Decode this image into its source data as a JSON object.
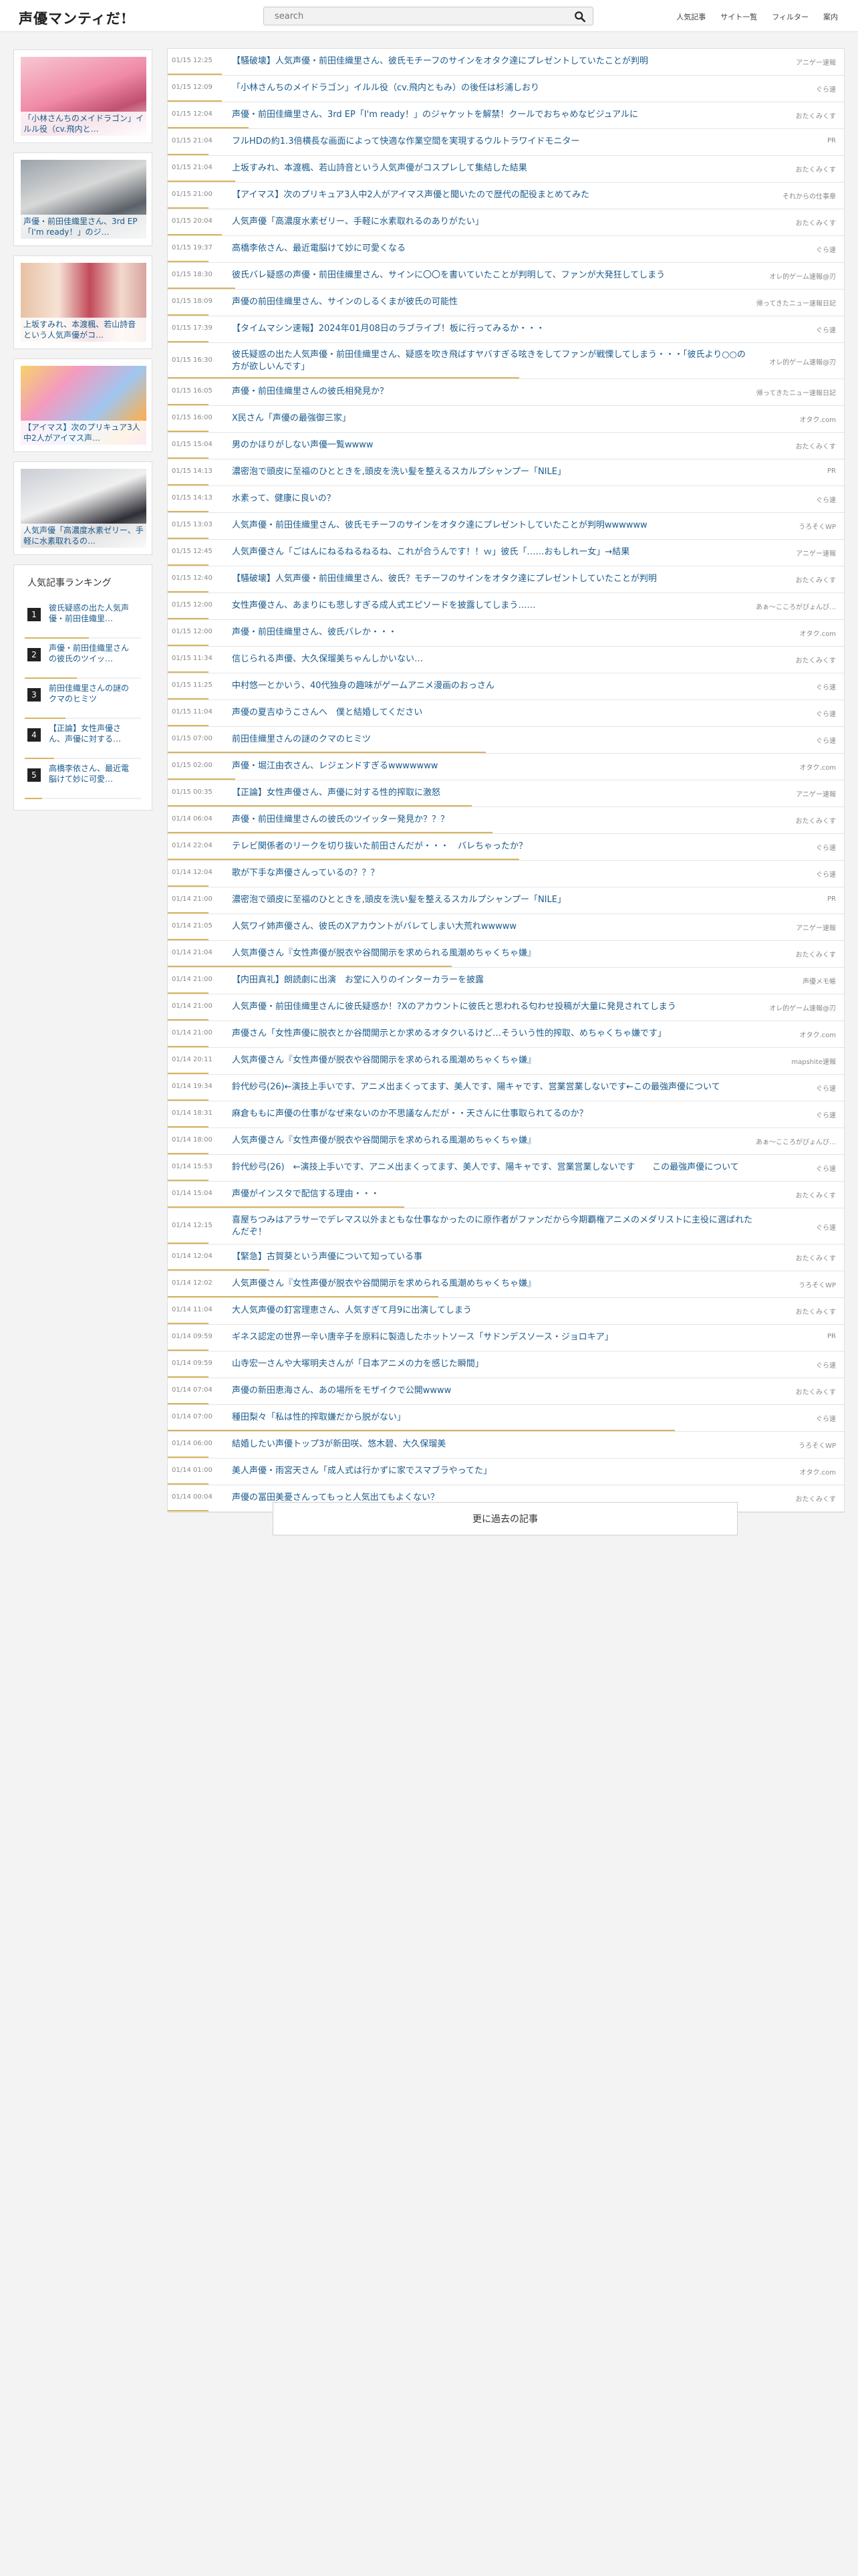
{
  "header": {
    "logo": "声優マンティだ!",
    "search_placeholder": "search",
    "nav": [
      "人気記事",
      "サイト一覧",
      "フィルター",
      "案内"
    ]
  },
  "sidebar": {
    "thumbnails": [
      {
        "caption": "「小林さんちのメイドラゴン」イルル役（cv.飛内と…"
      },
      {
        "caption": "声優・前田佳織里さん、3rd EP「I'm ready！」のジ…"
      },
      {
        "caption": "上坂すみれ、本渡楓、若山詩音という人気声優がコ…"
      },
      {
        "caption": "【アイマス】次のプリキュア3人中2人がアイマス声…"
      },
      {
        "caption": "人気声優「高濃度水素ゼリー、手軽に水素取れるの…"
      }
    ],
    "ranking": {
      "title": "人気記事ランキング",
      "items": [
        {
          "num": "1",
          "text": "彼氏疑惑の出た人気声優・前田佳織里…",
          "progress": 0.55
        },
        {
          "num": "2",
          "text": "声優・前田佳織里さんの彼氏のツイッ…",
          "progress": 0.45
        },
        {
          "num": "3",
          "text": "前田佳織里さんの謎のクマのヒミツ",
          "progress": 0.35
        },
        {
          "num": "4",
          "text": "【正論】女性声優さん、声優に対する…",
          "progress": 0.25
        },
        {
          "num": "5",
          "text": "高橋李依さん、最近電脳けて妙に可愛…",
          "progress": 0.15
        }
      ]
    }
  },
  "articles": [
    {
      "date": "01/15 12:25",
      "title": "【騒破壊】人気声優・前田佳織里さん、彼氏モチーフのサインをオタク達にプレゼントしていたことが判明",
      "source": "アニゲー速報",
      "progress": 0.08
    },
    {
      "date": "01/15 12:09",
      "title": "「小林さんちのメイドラゴン」イルル役（cv.飛内ともみ）の後任は杉浦しおり",
      "source": "ぐら速",
      "progress": 0.08
    },
    {
      "date": "01/15 12:04",
      "title": "声優・前田佳織里さん、3rd EP「I'm ready！」のジャケットを解禁！クールでおちゃめなビジュアルに",
      "source": "おたくみくす",
      "progress": 0.12
    },
    {
      "date": "01/15 21:04",
      "title": "フルHDの約1.3倍横長な画面によって快適な作業空間を実現するウルトラワイドモニター",
      "source": "PR",
      "progress": 0.06
    },
    {
      "date": "01/15 21:04",
      "title": "上坂すみれ、本渡楓、若山詩音という人気声優がコスプレして集結した結果",
      "source": "おたくみくす",
      "progress": 0.1
    },
    {
      "date": "01/15 21:00",
      "title": "【アイマス】次のプリキュア3人中2人がアイマス声優と聞いたので歴代の配役まとめてみた",
      "source": "それからの仕事章",
      "progress": 0.06
    },
    {
      "date": "01/15 20:04",
      "title": "人気声優「高濃度水素ゼリー、手軽に水素取れるのありがたい」",
      "source": "おたくみくす",
      "progress": 0.08
    },
    {
      "date": "01/15 19:37",
      "title": "高橋李依さん、最近電脳けて妙に可愛くなる",
      "source": "ぐら速",
      "progress": 0.06
    },
    {
      "date": "01/15 18:30",
      "title": "彼氏バレ疑惑の声優・前田佳織里さん、サインに〇〇を書いていたことが判明して、ファンが大発狂してしまう",
      "source": "オレ的ゲーム速報@刃",
      "progress": 0.1
    },
    {
      "date": "01/15 18:09",
      "title": "声優の前田佳織里さん、サインのしるくまが彼氏の可能性",
      "source": "帰ってきたニュー速報日記",
      "progress": 0.06
    },
    {
      "date": "01/15 17:39",
      "title": "【タイムマシン速報】2024年01月08日のラブライブ！板に行ってみるか・・・",
      "source": "ぐら速",
      "progress": 0.06
    },
    {
      "date": "01/15 16:30",
      "title": "彼氏疑惑の出た人気声優・前田佳織里さん、疑惑を吹き飛ばすヤバすぎる呟きをしてファンが戦慄してしまう・・・「彼氏より○○の方が欲しいんです」",
      "source": "オレ的ゲーム速報@刃",
      "progress": 0.52,
      "tall": true
    },
    {
      "date": "01/15 16:05",
      "title": "声優・前田佳織里さんの彼氏相発見か？",
      "source": "帰ってきたニュー速報日記",
      "progress": 0.06
    },
    {
      "date": "01/15 16:00",
      "title": "X民さん「声優の最強御三家」",
      "source": "オタク.com",
      "progress": 0.06
    },
    {
      "date": "01/15 15:04",
      "title": "男のかほりがしない声優一覧wwww",
      "source": "おたくみくす",
      "progress": 0.06
    },
    {
      "date": "01/15 14:13",
      "title": "濃密泡で頭皮に至福のひとときを,頭皮を洗い髪を整えるスカルプシャンプー「NILE」",
      "source": "PR",
      "progress": 0.06
    },
    {
      "date": "01/15 14:13",
      "title": "水素って、健康に良いの？",
      "source": "ぐら速",
      "progress": 0.06
    },
    {
      "date": "01/15 13:03",
      "title": "人気声優・前田佳織里さん、彼氏モチーフのサインをオタク達にプレゼントしていたことが判明wwwwww",
      "source": "うろそくWP",
      "progress": 0.06
    },
    {
      "date": "01/15 12:45",
      "title": "人気声優さん「ごはんにねるねるねるね、これが合うんです！！ｗ」彼氏「……おもしれー女」→結果",
      "source": "アニゲー速報",
      "progress": 0.06
    },
    {
      "date": "01/15 12:40",
      "title": "【騒破壊】人気声優・前田佳織里さん、彼氏？モチーフのサインをオタク達にプレゼントしていたことが判明",
      "source": "おたくみくす",
      "progress": 0.06
    },
    {
      "date": "01/15 12:00",
      "title": "女性声優さん、あまりにも悲しすぎる成人式エピソードを披露してしまう……",
      "source": "あぁ〜こころがぴょんぴ…",
      "progress": 0.06
    },
    {
      "date": "01/15 12:00",
      "title": "声優・前田佳織里さん、彼氏バレか・・・",
      "source": "オタク.com",
      "progress": 0.06
    },
    {
      "date": "01/15 11:34",
      "title": "信じられる声優、大久保瑠美ちゃんしかいない…",
      "source": "おたくみくす",
      "progress": 0.06
    },
    {
      "date": "01/15 11:25",
      "title": "中村悠一とかいう、40代独身の趣味がゲームアニメ漫画のおっさん",
      "source": "ぐら速",
      "progress": 0.06
    },
    {
      "date": "01/15 11:04",
      "title": "声優の夏吉ゆうこさんへ　僕と結婚してください",
      "source": "ぐら速",
      "progress": 0.06
    },
    {
      "date": "01/15 07:00",
      "title": "前田佳織里さんの謎のクマのヒミツ",
      "source": "ぐら速",
      "progress": 0.47
    },
    {
      "date": "01/15 02:00",
      "title": "声優・堀江由衣さん、レジェンドすぎるwwwwwww",
      "source": "オタク.com",
      "progress": 0.1
    },
    {
      "date": "01/15 00:35",
      "title": "【正論】女性声優さん、声優に対する性的搾取に激怒",
      "source": "アニゲー速報",
      "progress": 0.45
    },
    {
      "date": "01/14 06:04",
      "title": "声優・前田佳織里さんの彼氏のツイッター発見か？？？",
      "source": "おたくみくす",
      "progress": 0.48
    },
    {
      "date": "01/14 22:04",
      "title": "テレビ関係者のリークを切り抜いた前田さんだが・・・　バレちゃったか？",
      "source": "ぐら速",
      "progress": 0.52
    },
    {
      "date": "01/14 12:04",
      "title": "歌が下手な声優さんっているの？？？",
      "source": "ぐら速",
      "progress": 0.06
    },
    {
      "date": "01/14 21:00",
      "title": "濃密泡で頭皮に至福のひとときを,頭皮を洗い髪を整えるスカルプシャンプー「NILE」",
      "source": "PR",
      "progress": 0.06
    },
    {
      "date": "01/14 21:05",
      "title": "人気ワイ姉声優さん、彼氏のXアカウントがバレてしまい大荒れwwwww",
      "source": "アニゲー速報",
      "progress": 0.06
    },
    {
      "date": "01/14 21:04",
      "title": "人気声優さん『女性声優が脱衣や谷間開示を求められる風潮めちゃくちゃ嫌』",
      "source": "おたくみくす",
      "progress": 0.42
    },
    {
      "date": "01/14 21:00",
      "title": "【内田真礼】朗読劇に出演　お堂に入りのインターカラーを披露",
      "source": "声優メモ帳",
      "progress": 0.06
    },
    {
      "date": "01/14 21:00",
      "title": "人気声優・前田佳織里さんに彼氏疑惑か！?Xのアカウントに彼氏と思われる匂わせ投稿が大量に発見されてしまう",
      "source": "オレ的ゲーム速報@刃",
      "progress": 0.06
    },
    {
      "date": "01/14 21:00",
      "title": "声優さん「女性声優に脱衣とか谷間開示とか求めるオタクいるけど…そういう性的搾取、めちゃくちゃ嫌です」",
      "source": "オタク.com",
      "progress": 0.06
    },
    {
      "date": "01/14 20:11",
      "title": "人気声優さん『女性声優が脱衣や谷間開示を求められる風潮めちゃくちゃ嫌』",
      "source": "mapshite速報",
      "progress": 0.06
    },
    {
      "date": "01/14 19:34",
      "title": "鈴代紗弓(26)←演技上手いです、アニメ出まくってます、美人です、陽キャです、営業営業しないです←この最強声優について",
      "source": "ぐら速",
      "progress": 0.06
    },
    {
      "date": "01/14 18:31",
      "title": "麻倉ももに声優の仕事がなぜ来ないのか不思議なんだが・・天さんに仕事取られてるのか？",
      "source": "ぐら速",
      "progress": 0.06
    },
    {
      "date": "01/14 18:00",
      "title": "人気声優さん『女性声優が脱衣や谷間開示を求められる風潮めちゃくちゃ嫌』",
      "source": "あぁ〜こころがぴょんぴ…",
      "progress": 0.06
    },
    {
      "date": "01/14 15:53",
      "title": "鈴代紗弓(26)　←演技上手いです、アニメ出まくってます、美人です、陽キャです、営業営業しないです　　この最強声優について",
      "source": "ぐら速",
      "progress": 0.06
    },
    {
      "date": "01/14 15:04",
      "title": "声優がインスタで配信する理由・・・",
      "source": "おたくみくす",
      "progress": 0.35
    },
    {
      "date": "01/14 12:15",
      "title": "喜屋ちつみはアラサーでデレマス以外まともな仕事なかったのに原作者がファンだから今期覇権アニメのメダリストに主役に選ばれたんだぞ！",
      "source": "ぐら速",
      "progress": 0.06,
      "tall": true
    },
    {
      "date": "01/14 12:04",
      "title": "【緊急】古賀葵という声優について知っている事",
      "source": "おたくみくす",
      "progress": 0.15
    },
    {
      "date": "01/14 12:02",
      "title": "人気声優さん『女性声優が脱衣や谷間開示を求められる風潮めちゃくちゃ嫌』",
      "source": "うろそくWP",
      "progress": 0.4
    },
    {
      "date": "01/14 11:04",
      "title": "大人気声優の釘宮理恵さん、人気すぎて月9に出演してしまう",
      "source": "おたくみくす",
      "progress": 0.06
    },
    {
      "date": "01/14 09:59",
      "title": "ギネス認定の世界一辛い唐辛子を原料に製造したホットソース「サドンデスソース・ジョロキア」",
      "source": "PR",
      "progress": 0.06
    },
    {
      "date": "01/14 09:59",
      "title": "山寺宏一さんや大塚明夫さんが「日本アニメの力を感じた瞬間」",
      "source": "ぐら速",
      "progress": 0.06
    },
    {
      "date": "01/14 07:04",
      "title": "声優の新田恵海さん、あの場所をモザイクで公開wwww",
      "source": "おたくみくす",
      "progress": 0.06
    },
    {
      "date": "01/14 07:00",
      "title": "種田梨々「私は性的搾取嫌だから脱がない」",
      "source": "ぐら速",
      "progress": 0.75
    },
    {
      "date": "01/14 06:00",
      "title": "結婚したい声優トップ3が新田咲、悠木碧、大久保瑠美",
      "source": "うろそくWP",
      "progress": 0.06
    },
    {
      "date": "01/14 01:00",
      "title": "美人声優・雨宮天さん「成人式は行かずに家でスマブラやってた」",
      "source": "オタク.com",
      "progress": 0.06
    },
    {
      "date": "01/14 00:04",
      "title": "声優の冨田美憂さんってもっと人気出てもよくない？",
      "source": "おたくみくす",
      "progress": 0.06
    }
  ],
  "more_button": "更に過去の記事",
  "colors": {
    "accent_bar": "#d8b460",
    "link": "#1a5a8c",
    "header_bg": "#ffffff",
    "page_bg": "#f3f3f3"
  },
  "icons": {
    "search": "search-icon"
  }
}
